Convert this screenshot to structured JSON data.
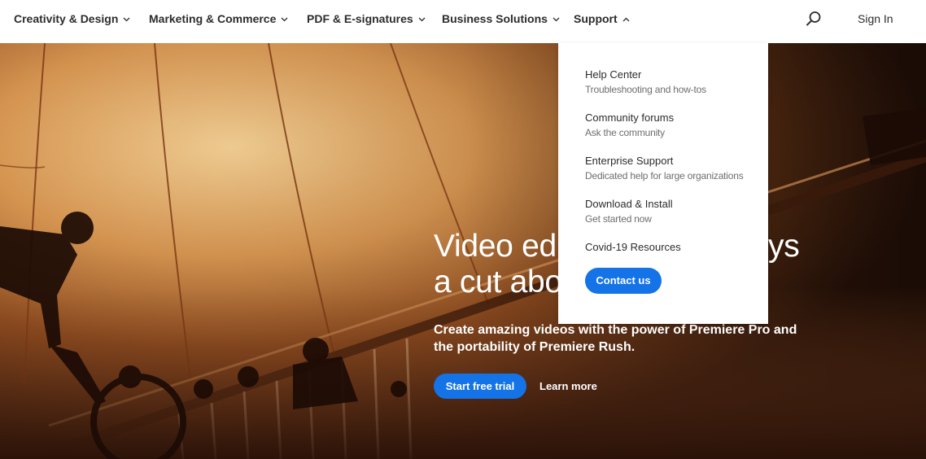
{
  "nav": {
    "items": [
      {
        "label": "Creativity & Design"
      },
      {
        "label": "Marketing & Commerce"
      },
      {
        "label": "PDF & E-signatures"
      },
      {
        "label": "Business Solutions"
      },
      {
        "label": "Support"
      }
    ],
    "signin_label": "Sign In",
    "search_icon": "search-icon"
  },
  "support_menu": {
    "items": [
      {
        "title": "Help Center",
        "desc": "Troubleshooting and how-tos"
      },
      {
        "title": "Community forums",
        "desc": "Ask the community"
      },
      {
        "title": "Enterprise Support",
        "desc": "Dedicated help for large organizations"
      },
      {
        "title": "Download & Install",
        "desc": "Get started now"
      },
      {
        "title": "Covid-19 Resources"
      }
    ],
    "contact_label": "Contact us"
  },
  "hero": {
    "headline_line1": "Video ed",
    "headline_line1_tail": "ys",
    "headline_line2": "a cut abo",
    "subtitle": "Create amazing videos with the power of Premiere Pro and the portability of Premiere Rush.",
    "cta_primary": "Start free trial",
    "cta_secondary": "Learn more"
  },
  "colors": {
    "accent_blue": "#1473e6",
    "nav_text": "#2c2c2c",
    "desc_text": "#6e6e6e"
  }
}
